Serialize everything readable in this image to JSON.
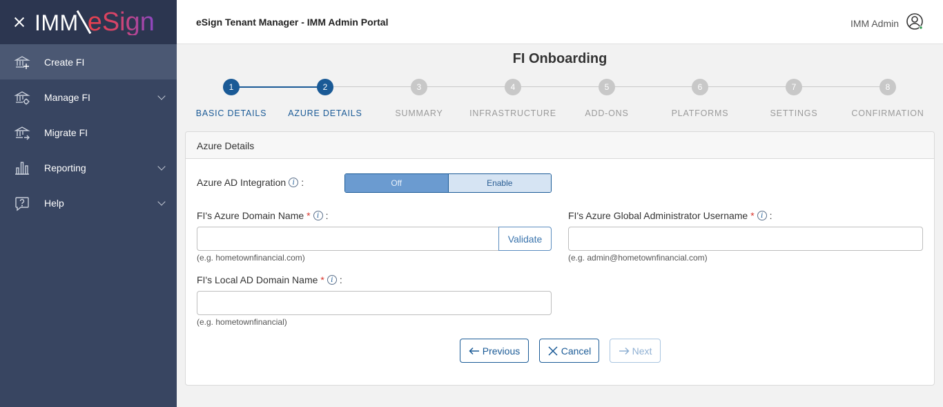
{
  "brand": {
    "logo_imm": "IMM",
    "logo_esign": "eSign"
  },
  "sidebar": {
    "items": [
      {
        "label": "Create FI",
        "icon": "bank-add-icon",
        "active": true
      },
      {
        "label": "Manage FI",
        "icon": "bank-gear-icon",
        "expandable": true
      },
      {
        "label": "Migrate FI",
        "icon": "bank-arrow-icon"
      },
      {
        "label": "Reporting",
        "icon": "bar-chart-icon",
        "expandable": true
      },
      {
        "label": "Help",
        "icon": "help-bubble-icon",
        "expandable": true
      }
    ]
  },
  "header": {
    "title": "eSign Tenant Manager - IMM Admin Portal",
    "user": "IMM Admin"
  },
  "page": {
    "title": "FI Onboarding"
  },
  "stepper": {
    "steps": [
      {
        "number": "1",
        "label": "BASIC DETAILS",
        "active": true
      },
      {
        "number": "2",
        "label": "AZURE DETAILS",
        "active": true
      },
      {
        "number": "3",
        "label": "SUMMARY"
      },
      {
        "number": "4",
        "label": "INFRASTRUCTURE"
      },
      {
        "number": "5",
        "label": "ADD-ONS"
      },
      {
        "number": "6",
        "label": "PLATFORMS"
      },
      {
        "number": "7",
        "label": "SETTINGS"
      },
      {
        "number": "8",
        "label": "CONFIRMATION"
      }
    ]
  },
  "form": {
    "section_title": "Azure Details",
    "azure_ad": {
      "label": "Azure AD Integration",
      "colon": ":",
      "off": "Off",
      "enable": "Enable",
      "selected": "Off"
    },
    "domain_name": {
      "label": "FI's Azure Domain Name",
      "required": "*",
      "colon": ":",
      "value": "",
      "placeholder": "",
      "validate": "Validate",
      "hint": "(e.g. hometownfinancial.com)"
    },
    "admin_username": {
      "label": "FI's Azure Global Administrator Username",
      "required": "*",
      "colon": ":",
      "value": "",
      "placeholder": "",
      "hint": "(e.g. admin@hometownfinancial.com)"
    },
    "local_domain": {
      "label": "FI's Local AD Domain Name",
      "required": "*",
      "colon": ":",
      "value": "",
      "placeholder": "",
      "hint": "(e.g. hometownfinancial)"
    }
  },
  "actions": {
    "previous": "Previous",
    "cancel": "Cancel",
    "next": "Next"
  },
  "colors": {
    "primary": "#1a5a96",
    "sidebar": "#384561",
    "sidebar_active": "#4b5873",
    "required": "#d9342b"
  }
}
